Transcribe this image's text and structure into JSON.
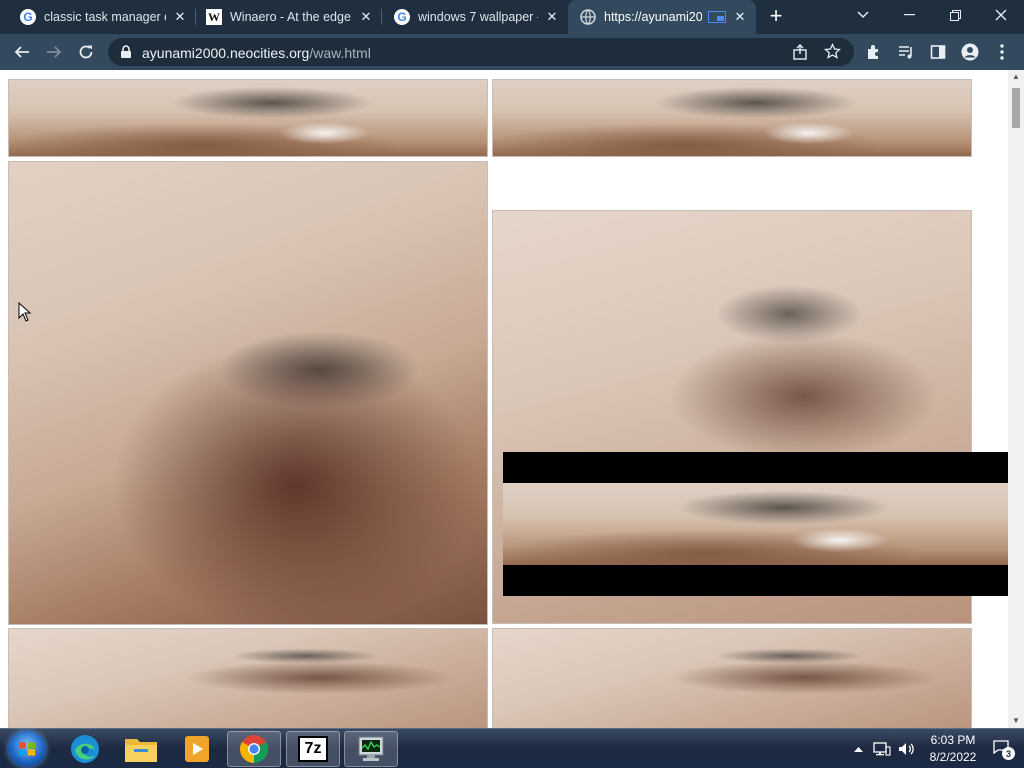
{
  "browser": {
    "tabs": [
      {
        "title": "classic task manager do",
        "favicon": "google-icon",
        "active": false
      },
      {
        "title": "Winaero - At the edge",
        "favicon": "winaero-icon",
        "active": false
      },
      {
        "title": "windows 7 wallpaper -",
        "favicon": "google-icon",
        "active": false
      },
      {
        "title": "https://ayunami20",
        "favicon": "globe-icon",
        "active": true
      }
    ],
    "url_host": "ayunami2000.neocities.org",
    "url_path": "/waw.html"
  },
  "taskbar": {
    "apps": [
      "start-orb",
      "edge",
      "file-explorer",
      "media-player",
      "chrome",
      "7zip",
      "task-manager"
    ],
    "sevenzip_label": "7z",
    "clock_time": "6:03 PM",
    "clock_date": "8/2/2022",
    "notification_count": "3"
  },
  "colors": {
    "tabstrip": "#1f2f3f",
    "toolbar": "#334a5e",
    "taskbar": "#1c2941"
  }
}
